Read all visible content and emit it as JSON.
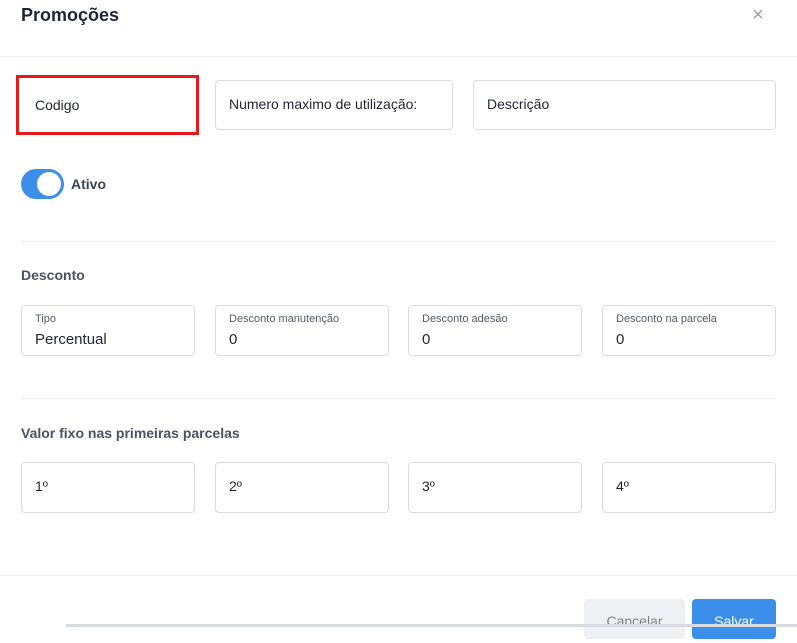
{
  "modal": {
    "title": "Promoções",
    "close_icon": "close-icon"
  },
  "top_fields": {
    "codigo": {
      "placeholder": "Codigo"
    },
    "max_uses": {
      "placeholder": "Numero maximo de utilização:"
    },
    "description": {
      "placeholder": "Descrição"
    }
  },
  "toggle": {
    "label": "Ativo",
    "on": true,
    "color": "#3b8fe8"
  },
  "desconto": {
    "title": "Desconto",
    "fields": [
      {
        "label": "Tipo",
        "value": "Percentual"
      },
      {
        "label": "Desconto manutenção",
        "value": "0"
      },
      {
        "label": "Desconto adesão",
        "value": "0"
      },
      {
        "label": "Desconto na parcela",
        "value": "0"
      }
    ]
  },
  "valor_fixo": {
    "title": "Valor fixo nas primeiras parcelas",
    "fields": [
      {
        "placeholder": "1º"
      },
      {
        "placeholder": "2º"
      },
      {
        "placeholder": "3º"
      },
      {
        "placeholder": "4º"
      }
    ]
  },
  "footer": {
    "cancel_label": "Cancelar",
    "save_label": "Salvar"
  },
  "colors": {
    "accent": "#3b8fe8",
    "highlight": "#e6191b"
  }
}
